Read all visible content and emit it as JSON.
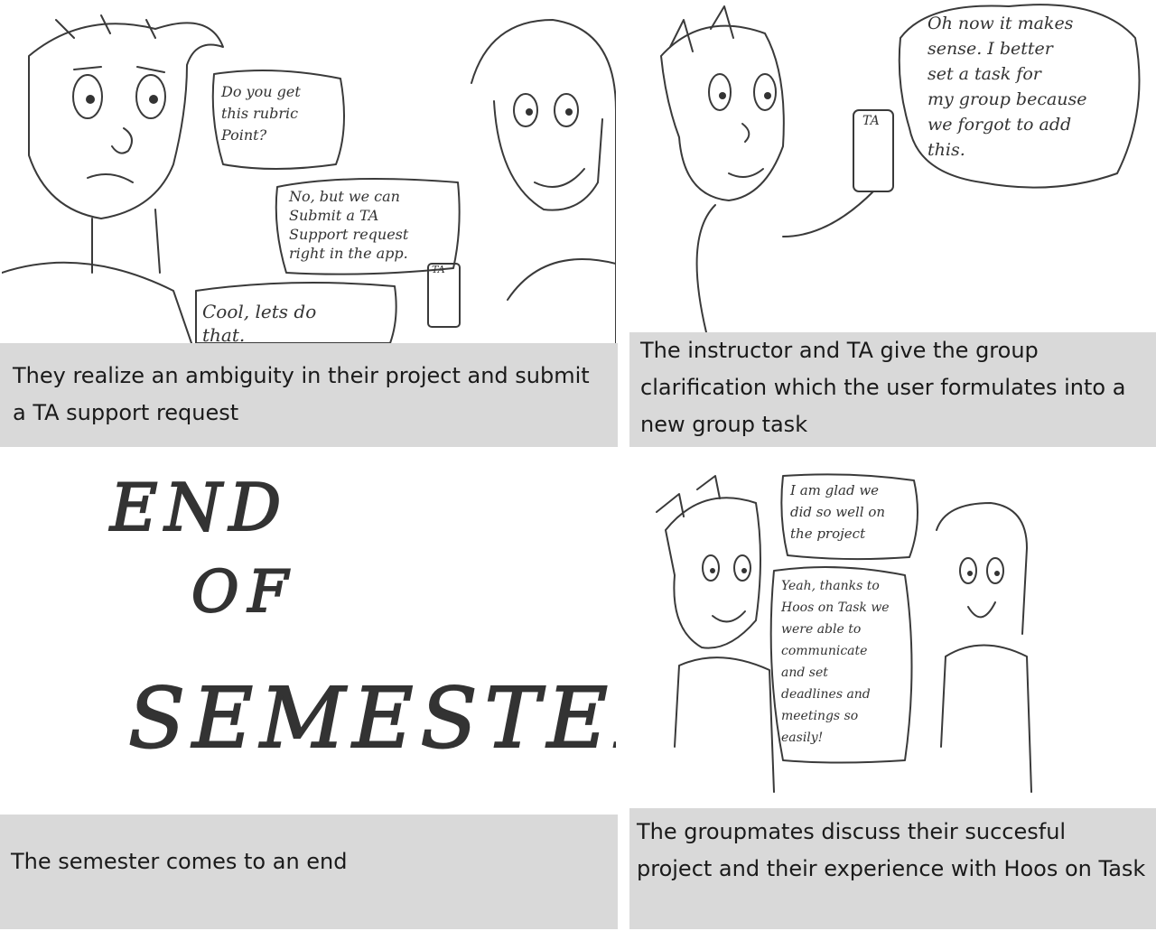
{
  "panels": [
    {
      "bubbles": {
        "question": "Do you get\nthis rubric\nPoint?",
        "answer": "No, but we can\nSubmit a TA\nSupport request\nright in the app.",
        "reply": "Cool, lets do\nthat.",
        "phone_label": "TA"
      },
      "caption": "They realize an ambiguity in their project and submit a TA support request"
    },
    {
      "bubbles": {
        "thought": "Oh now it makes\nsense. I better\nset a task for\nmy group because\nwe forgot to add\nthis.",
        "phone_label": "TA"
      },
      "caption": "The instructor and TA give the group clarification which the user formulates into a new group task"
    },
    {
      "title_lines": [
        "END",
        "OF",
        "SEMESTER"
      ],
      "caption": "The semester comes to an end"
    },
    {
      "bubbles": {
        "top": "I am glad we\ndid so well on\nthe project",
        "bottom": "Yeah, thanks to\nHoos on Task we\nwere able to\ncommunicate\nand set\ndeadlines and\nmeetings so\neasily!"
      },
      "caption": "The groupmates discuss their succesful project and their experience with Hoos on Task"
    }
  ]
}
